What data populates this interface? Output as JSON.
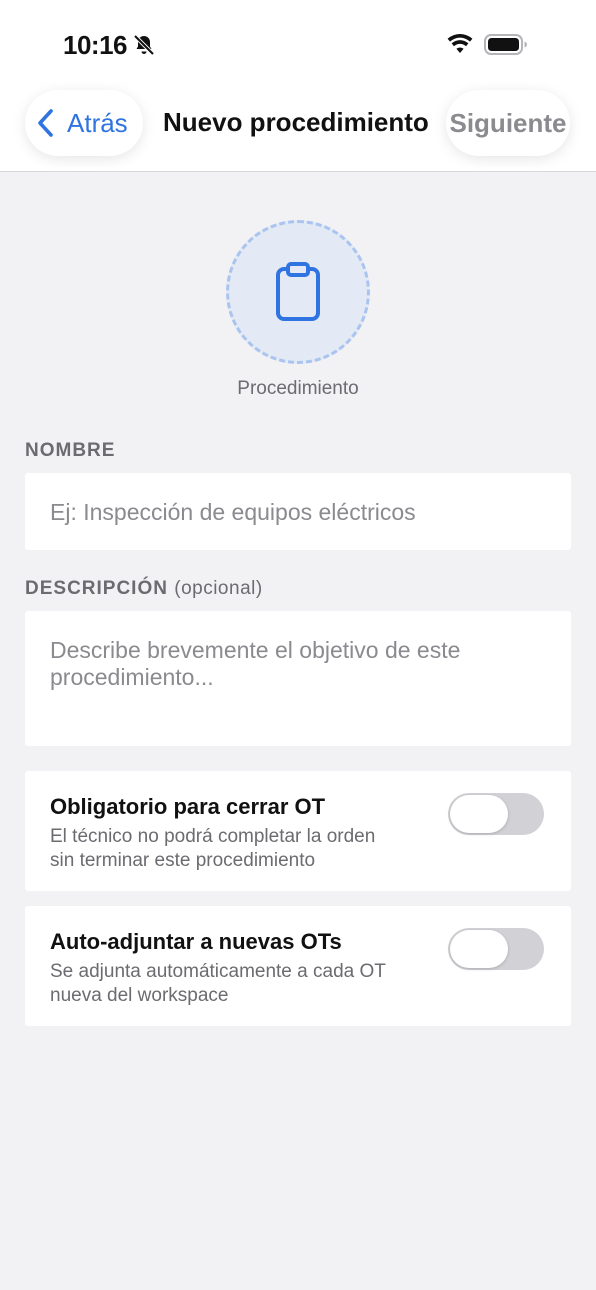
{
  "status_bar": {
    "time": "10:16",
    "icons": [
      "bell-slash-icon",
      "wifi-icon",
      "battery-icon"
    ]
  },
  "nav": {
    "back_label": "Atrás",
    "title": "Nuevo procedimiento",
    "next_label": "Siguiente"
  },
  "header_icon": {
    "icon": "clipboard-icon",
    "label": "Procedimiento"
  },
  "form": {
    "name_label": "NOMBRE",
    "name_placeholder": "Ej: Inspección de equipos eléctricos",
    "description_label": "DESCRIPCIÓN",
    "description_optional": "(opcional)",
    "description_placeholder_line1": "Describe brevemente el objetivo de este",
    "description_placeholder_line2": "procedimiento..."
  },
  "options": [
    {
      "title": "Obligatorio para cerrar OT",
      "desc_line1": "El técnico no podrá completar la orden",
      "desc_line2": "sin terminar este procedimiento",
      "enabled": false
    },
    {
      "title": "Auto-adjuntar a nuevas OTs",
      "desc_line1": "Se adjunta automáticamente a cada OT",
      "desc_line2": "nueva del workspace",
      "enabled": false
    }
  ],
  "colors": {
    "accent": "#2f74e0",
    "background": "#f2f2f5",
    "toggle_off": "#d1d1d6",
    "muted_text": "#6b6b70"
  }
}
